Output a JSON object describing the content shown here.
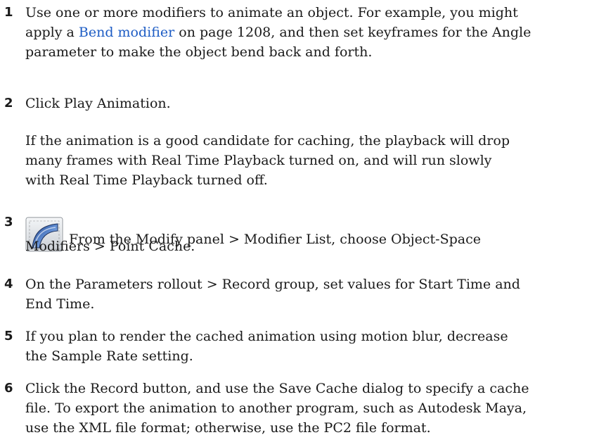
{
  "steps": [
    {
      "num": "1",
      "l1": "Use one or more modifiers to animate an object. For example, you might",
      "l2_pre": "apply a ",
      "l2_link": "Bend modifier",
      "l2_post": " on page 1208, and then set keyframes for the Angle",
      "l3": "parameter to make the object bend back and forth."
    },
    {
      "num": "2",
      "l1": "Click Play Animation.",
      "p1": "If the animation is a good candidate for caching, the playback will drop",
      "p2": "many frames with Real Time Playback turned on, and will run slowly",
      "p3": "with Real Time Playback turned off."
    },
    {
      "num": "3",
      "icon": "bend-modifier-icon",
      "l1": "From the Modify panel > Modifier List, choose Object-Space",
      "l2": "Modifiers > Point Cache."
    },
    {
      "num": "4",
      "l1": "On the Parameters rollout > Record group, set values for Start Time and",
      "l2": "End Time."
    },
    {
      "num": "5",
      "l1": "If you plan to render the cached animation using motion blur, decrease",
      "l2": "the Sample Rate setting."
    },
    {
      "num": "6",
      "l1": "Click the Record button, and use the Save Cache dialog to specify a cache",
      "l2": "file. To export the animation to another program, such as Autodesk Maya,",
      "l3": "use the XML file format; otherwise, use the PC2 file format."
    }
  ]
}
